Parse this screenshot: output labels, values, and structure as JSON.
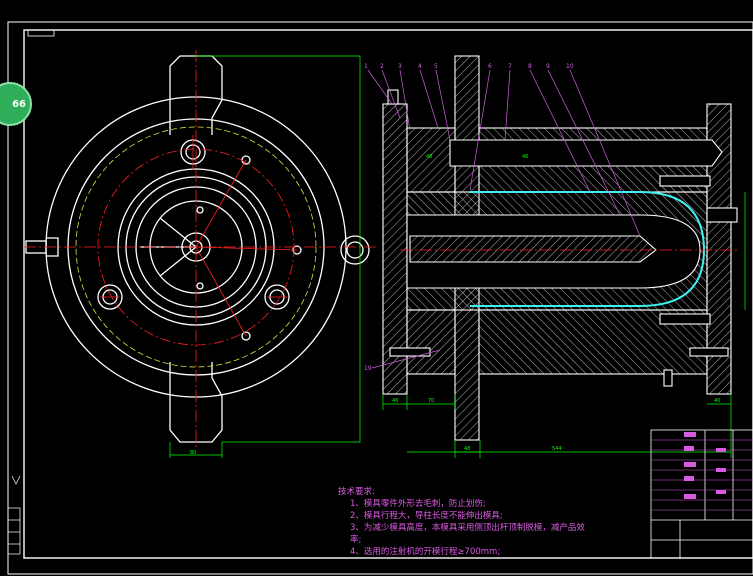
{
  "badge": {
    "text": "66"
  },
  "dims": {
    "left_width": "80",
    "b1": "46",
    "b2": "70",
    "b3": "48",
    "total": "544",
    "b4": "40",
    "v1": "48",
    "v2": "46"
  },
  "balloons": [
    "1",
    "2",
    "3",
    "4",
    "5",
    "6",
    "7",
    "8",
    "9",
    "10",
    "19"
  ],
  "tech_notes": {
    "title": "技术要求:",
    "line1": "1、模具零件外形去毛刺，防止划伤;",
    "line2": "2、模具行程大，导柱长度不能伸出模具;",
    "line3": "3、为减少模具高度，本模具采用侧顶出杆顶制脱模，减产品效",
    "line3b": "率;",
    "line4": "4、选用的注射机的开模行程≥700mm;"
  },
  "colors": {
    "bg": "#000000",
    "line": "#ffffff",
    "center": "#ff2020",
    "dim": "#00ff00",
    "leader": "#d060e0",
    "yellow": "#e0e040",
    "cyan": "#40f0f0",
    "note": "#d85ae0"
  }
}
